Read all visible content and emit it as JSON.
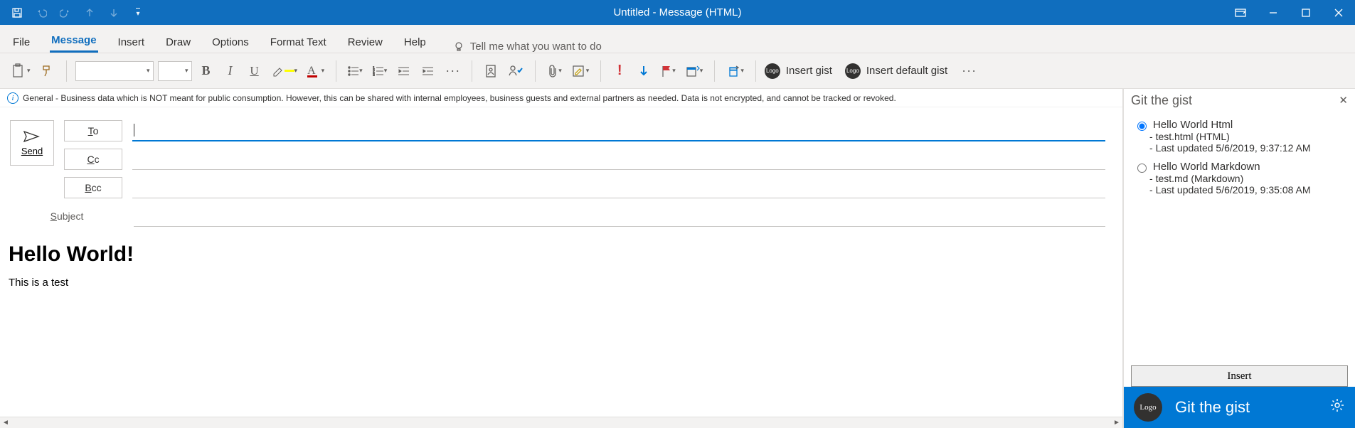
{
  "title": "Untitled  -  Message (HTML)",
  "qat_save": "Save",
  "tabs": [
    "File",
    "Message",
    "Insert",
    "Draw",
    "Options",
    "Format Text",
    "Review",
    "Help"
  ],
  "active_tab": "Message",
  "tell_me": "Tell me what you want to do",
  "insert_gist": "Insert gist",
  "insert_default_gist": "Insert default gist",
  "infobar": "General - Business data which is NOT meant for public consumption. However, this can be shared with internal employees, business guests and external partners as needed. Data is not encrypted, and cannot be tracked or revoked.",
  "send": "Send",
  "to": "To",
  "cc": "Cc",
  "bcc": "Bcc",
  "subject_label": "Subject",
  "body_heading": "Hello World!",
  "body_text": "This is a test",
  "pane_title": "Git the gist",
  "gists": [
    {
      "title": "Hello World Html",
      "file": "test.html (HTML)",
      "updated": "Last updated 5/6/2019, 9:37:12 AM",
      "selected": true
    },
    {
      "title": "Hello World Markdown",
      "file": "test.md (Markdown)",
      "updated": "Last updated 5/6/2019, 9:35:08 AM",
      "selected": false
    }
  ],
  "insert_button": "Insert",
  "footer_logo": "Logo",
  "footer_title": "Git the gist"
}
